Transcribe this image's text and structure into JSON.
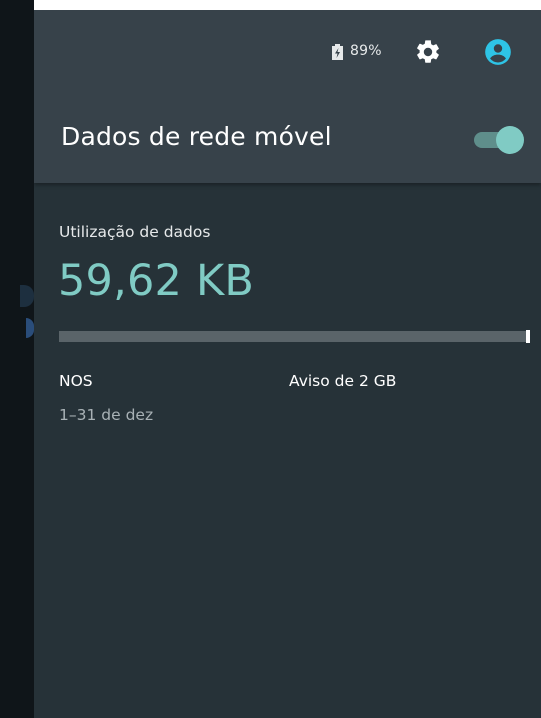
{
  "status": {
    "battery_percent_text": "89%",
    "icons": [
      "battery-charging-icon",
      "gear-icon",
      "account-circle-icon"
    ]
  },
  "header": {
    "title": "Dados de rede móvel",
    "toggle_on": true
  },
  "usage": {
    "label": "Utilização de dados",
    "value": "59,62 KB",
    "progress_fraction": 0.0
  },
  "details": {
    "carrier": "NOS",
    "period": "1–31 de dez",
    "warning": "Aviso de 2 GB"
  },
  "colors": {
    "panel_bg": "#263238",
    "header_bg": "#37424a",
    "accent": "#80cbc4"
  }
}
